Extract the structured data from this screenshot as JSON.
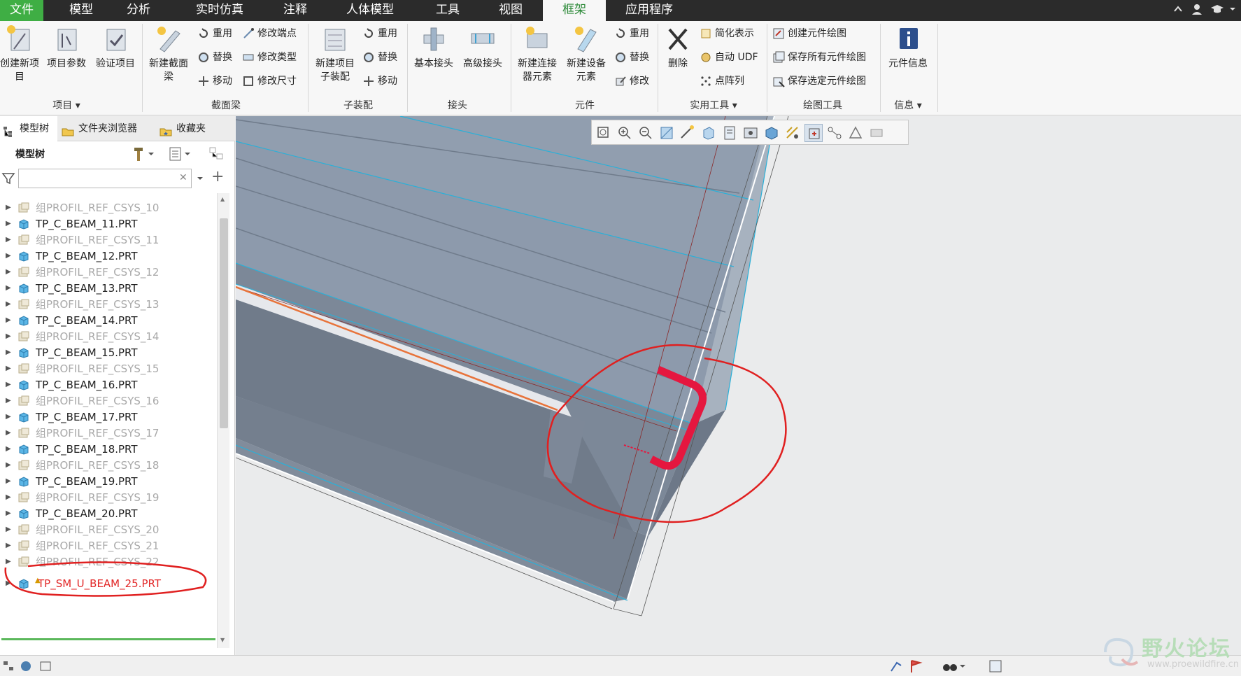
{
  "menubar": {
    "tabs": [
      {
        "label": "文件"
      },
      {
        "label": "模型"
      },
      {
        "label": "分析"
      },
      {
        "label": "实时仿真"
      },
      {
        "label": "注释"
      },
      {
        "label": "人体模型"
      },
      {
        "label": "工具"
      },
      {
        "label": "视图"
      },
      {
        "label": "框架"
      },
      {
        "label": "应用程序"
      }
    ],
    "active_tab": "框架"
  },
  "ribbon": {
    "groups": {
      "project": {
        "label": "项目",
        "new_item": "创建新项\n目",
        "item_params": "项目参数",
        "verify_item": "验证项目"
      },
      "section": {
        "label": "截面梁",
        "new_section_beam": "新建截面\n梁",
        "reuse": "重用",
        "modify_endpoint": "修改端点",
        "replace": "替换",
        "modify_type": "修改类型",
        "move": "移动",
        "modify_size": "修改尺寸"
      },
      "subassembly": {
        "label": "子装配",
        "new_sub": "新建项目\n子装配",
        "reuse": "重用",
        "replace": "替换",
        "move": "移动"
      },
      "joint": {
        "label": "接头",
        "basic": "基本接头",
        "advanced": "高级接头"
      },
      "element": {
        "label": "元件",
        "new_connector": "新建连接\n器元素",
        "new_device": "新建设备\n元素",
        "reuse": "重用",
        "replace": "替换",
        "modify": "修改"
      },
      "utility": {
        "label": "实用工具",
        "delete": "删除",
        "simplified_rep": "简化表示",
        "auto_udf": "自动 UDF",
        "point_array": "点阵列"
      },
      "drawing": {
        "label": "绘图工具",
        "create_drawing": "创建元件绘图",
        "save_all_drawings": "保存所有元件绘图",
        "save_selected_drawings": "保存选定元件绘图"
      },
      "info": {
        "label": "信息",
        "element_info": "元件信息"
      }
    }
  },
  "left_panel": {
    "tabs": [
      {
        "label": "模型树"
      },
      {
        "label": "文件夹浏览器"
      },
      {
        "label": "收藏夹"
      }
    ],
    "tree_title": "模型树",
    "search": {
      "value": "",
      "placeholder": ""
    },
    "items": [
      {
        "label": "组PROFIL_REF_CSYS_10",
        "kind": "group"
      },
      {
        "label": "TP_C_BEAM_11.PRT",
        "kind": "part"
      },
      {
        "label": "组PROFIL_REF_CSYS_11",
        "kind": "group"
      },
      {
        "label": "TP_C_BEAM_12.PRT",
        "kind": "part"
      },
      {
        "label": "组PROFIL_REF_CSYS_12",
        "kind": "group"
      },
      {
        "label": "TP_C_BEAM_13.PRT",
        "kind": "part"
      },
      {
        "label": "组PROFIL_REF_CSYS_13",
        "kind": "group"
      },
      {
        "label": "TP_C_BEAM_14.PRT",
        "kind": "part"
      },
      {
        "label": "组PROFIL_REF_CSYS_14",
        "kind": "group"
      },
      {
        "label": "TP_C_BEAM_15.PRT",
        "kind": "part"
      },
      {
        "label": "组PROFIL_REF_CSYS_15",
        "kind": "group"
      },
      {
        "label": "TP_C_BEAM_16.PRT",
        "kind": "part"
      },
      {
        "label": "组PROFIL_REF_CSYS_16",
        "kind": "group"
      },
      {
        "label": "TP_C_BEAM_17.PRT",
        "kind": "part"
      },
      {
        "label": "组PROFIL_REF_CSYS_17",
        "kind": "group"
      },
      {
        "label": "TP_C_BEAM_18.PRT",
        "kind": "part"
      },
      {
        "label": "组PROFIL_REF_CSYS_18",
        "kind": "group"
      },
      {
        "label": "TP_C_BEAM_19.PRT",
        "kind": "part"
      },
      {
        "label": "组PROFIL_REF_CSYS_19",
        "kind": "group"
      },
      {
        "label": "TP_C_BEAM_20.PRT",
        "kind": "part"
      },
      {
        "label": "组PROFIL_REF_CSYS_20",
        "kind": "group"
      },
      {
        "label": "组PROFIL_REF_CSYS_21",
        "kind": "group"
      },
      {
        "label": "组PROFIL_REF_CSYS_22",
        "kind": "group"
      },
      {
        "label": "TP_SM_U_BEAM_25.PRT",
        "kind": "highlight"
      }
    ]
  },
  "watermark": {
    "text": "野火论坛",
    "url": "www.proewildfire.cn"
  },
  "colors": {
    "menubar_bg": "#2b2b2b",
    "file_tab_bg": "#3fae44",
    "active_tab_text": "#2e8b3a",
    "beam_highlight": "#e5173f",
    "annotation_red": "#e02020",
    "edge_cyan": "#2ab0d8",
    "orange_edge": "#e8733a"
  }
}
